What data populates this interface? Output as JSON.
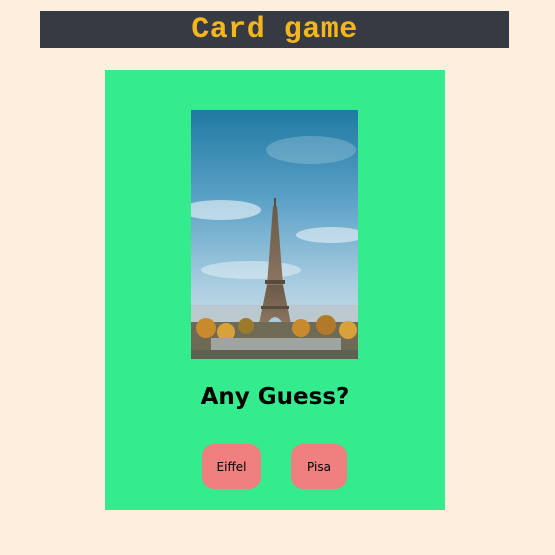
{
  "header": {
    "title": "Card game"
  },
  "card": {
    "image_icon": "eiffel-tower-photo",
    "question": "Any Guess?",
    "options": [
      {
        "label": "Eiffel"
      },
      {
        "label": "Pisa"
      }
    ]
  },
  "colors": {
    "page_background": "#fdeedd",
    "header_background": "#363a42",
    "header_text": "#f6b51d",
    "card_background": "#34eb8e",
    "button_background": "#f07f7f"
  }
}
